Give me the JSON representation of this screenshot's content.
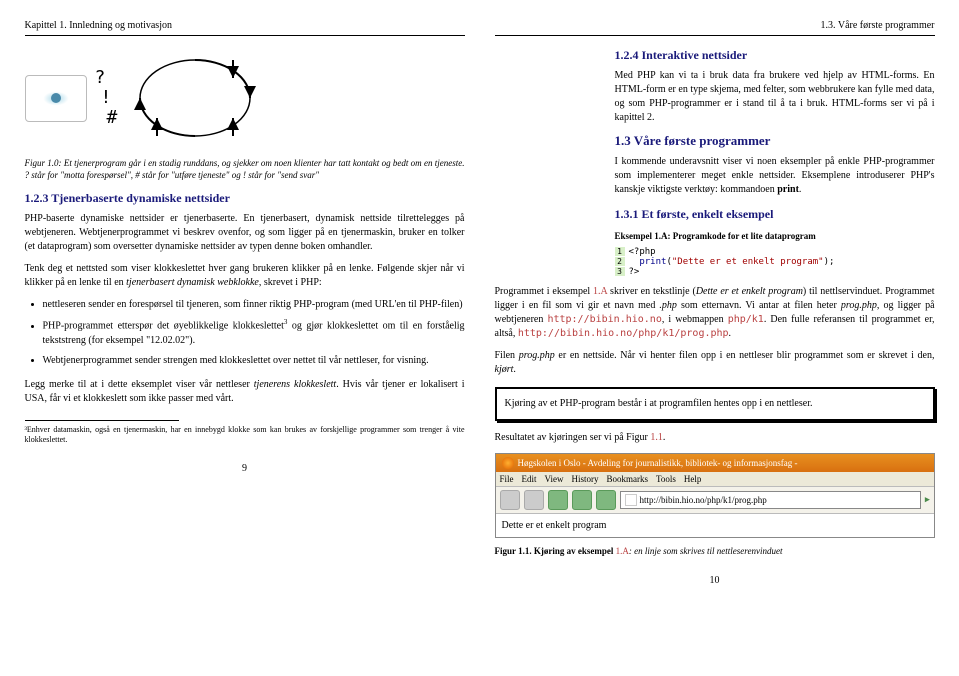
{
  "left": {
    "hdr_l": "Kapittel 1. Innledning og motivasjon",
    "marks": {
      "q": "?",
      "e": "!",
      "h": "#"
    },
    "figcap": "Figur 1.0: Et tjenerprogram går i en stadig runddans, og sjekker om noen klienter har tatt kontakt og bedt om en tjeneste. ? står for \"motta forespørsel\", # står for \"utføre tjeneste\" og ! står for \"send svar\"",
    "h123": "1.2.3 Tjenerbaserte dynamiske nettsider",
    "p1": "PHP-baserte dynamiske nettsider er tjenerbaserte. En tjenerbasert, dynamisk nettside tilrettelegges på webtjeneren. Webtjenerprogrammet vi beskrev ovenfor, og som ligger på en tjenermaskin, bruker en tolker (et dataprogram) som oversetter dynamiske nettsider av typen denne boken omhandler.",
    "p2a": "Tenk deg et nettsted som viser klokkeslettet hver gang brukeren klikker på en lenke. Følgende skjer når vi klikker på en lenke til en ",
    "p2i": "tjenerbasert dynamisk webklokke",
    "p2b": ", skrevet i PHP:",
    "li1": "nettleseren sender en forespørsel til tjeneren, som finner riktig PHP-program (med URL'en til PHP-filen)",
    "li2a": "PHP-programmet etterspør det øyeblikkelige klokkeslettet",
    "li2b": " og gjør klokkeslettet om til en forståelig tekststreng (for eksempel \"12.02.02\").",
    "li3": "Webtjenerprogrammet sender strengen med klokkeslettet over nettet til vår nettleser, for visning.",
    "p3a": "Legg merke til at i dette eksemplet viser vår nettleser ",
    "p3i": "tjenerens klokkeslett",
    "p3b": ". Hvis vår tjener er lokalisert i USA, får vi et klokkeslett som ikke passer med vårt.",
    "fn3": "³Enhver datamaskin, også en tjenermaskin, har en innebygd klokke som kan brukes av forskjellige programmer som trenger å vite klokkeslettet.",
    "pgn": "9"
  },
  "right": {
    "hdr_r": "1.3. Våre første programmer",
    "h124": "1.2.4 Interaktive nettsider",
    "p124": "Med PHP kan vi ta i bruk data fra brukere ved hjelp av HTML-forms. En HTML-form er en type skjema, med felter, som webbrukere kan fylle med data, og som PHP-programmer er i stand til å ta i bruk. HTML-forms ser vi på i kapittel 2.",
    "h13": "1.3 Våre første programmer",
    "p13a": "I kommende underavsnitt viser vi noen eksempler på enkle PHP-programmer som implementerer meget enkle nettsider. Eksemplene introduserer PHP's kanskje viktigste verktøy: kommandoen ",
    "p13b": "print",
    "p13c": ".",
    "h131": "1.3.1 Et første, enkelt eksempel",
    "exA": "Eksempel 1.A: Programkode for et lite dataprogram",
    "code": {
      "l1": "<?php",
      "l2a": "print",
      "l2b": "(",
      "l2c": "\"Dette er et enkelt program\"",
      "l2d": ");",
      "l3": "?>"
    },
    "pA1a": "Programmet i eksempel ",
    "pA1x": "1.A",
    "pA1b": " skriver en tekstlinje (",
    "pA1i": "Dette er et enkelt program",
    "pA1c": ") til nettlservinduet. Programmet ligger i en fil som vi gir et navn med ",
    "pA1d": ".php",
    "pA1e": " som etternavn. Vi antar at filen heter ",
    "pA1f": "prog.php",
    "pA1g": ", og ligger på webtjeneren ",
    "url1": "http://bibin.hio.no",
    "pA1h": ", i webmappen ",
    "url2": "php/k1",
    "pA1i2": ". Den fulle referansen til programmet er, altså, ",
    "url3": "http://bibin.hio.no/php/k1/prog.php",
    "pA1j": ".",
    "pA2a": "Filen ",
    "pA2f": "prog.php",
    "pA2b": " er en nettside. Når vi henter filen opp i en nettleser blir programmet som er skrevet i den, ",
    "pA2i": "kjørt",
    "pA2c": ".",
    "box": "Kjøring av et PHP-program består i at programfilen hentes opp i en nettleser.",
    "pres": "Resultatet av kjøringen ser vi på Figur ",
    "presl": "1.1",
    "presc": ".",
    "browser": {
      "title": "Høgskolen i Oslo - Avdeling for journalistikk, bibliotek- og informasjonsfag - ",
      "menu": [
        "File",
        "Edit",
        "View",
        "History",
        "Bookmarks",
        "Tools",
        "Help"
      ],
      "url": "http://bibin.hio.no/php/k1/prog.php",
      "body": "Dette er et enkelt program"
    },
    "fig11a": "Figur 1.1. Kjøring av eksempel ",
    "fig11l": "1.A",
    "fig11b": ": en linje som skrives til nettleserenvinduet",
    "pgn": "10"
  }
}
